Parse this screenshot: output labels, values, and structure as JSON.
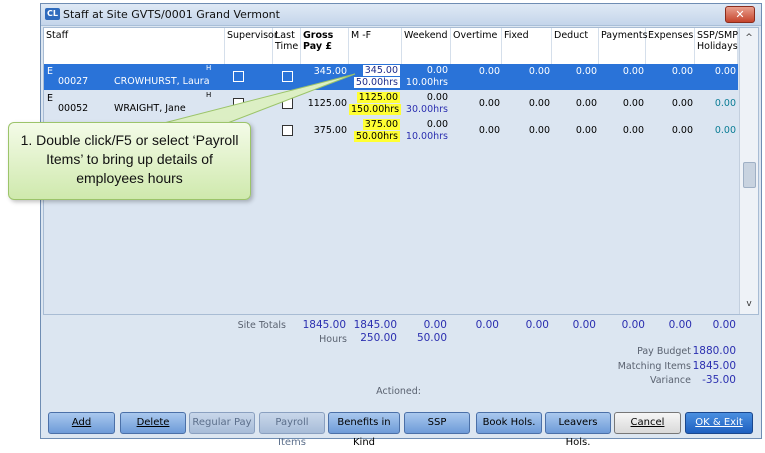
{
  "window": {
    "title": "Staff at Site GVTS/0001 Grand Vermont",
    "icon_text": "CL",
    "close": "✕"
  },
  "columns": [
    {
      "label": "Staff",
      "bold": false
    },
    {
      "label": "Supervisor",
      "bold": false
    },
    {
      "label": "Last Time",
      "bold": false
    },
    {
      "label": "Gross Pay £",
      "bold": true
    },
    {
      "label": "M -F",
      "bold": false
    },
    {
      "label": "Weekend",
      "bold": false
    },
    {
      "label": "Overtime",
      "bold": false
    },
    {
      "label": "Fixed",
      "bold": false
    },
    {
      "label": "Deduct",
      "bold": false
    },
    {
      "label": "Payments",
      "bold": false
    },
    {
      "label": "Expenses",
      "bold": false
    },
    {
      "label": "SSP/SMP Holidays",
      "bold": false
    }
  ],
  "rows": [
    {
      "type": "E",
      "flag": "H",
      "id": "00027",
      "name": "CROWHURST, Laura",
      "gross": "345.00",
      "mf": "345.00",
      "mf_hrs": "50.00hrs",
      "weekend": "0.00",
      "weekend_hrs": "10.00hrs",
      "overtime": "0.00",
      "fixed": "0.00",
      "deduct": "0.00",
      "payments": "0.00",
      "expenses": "0.00",
      "ssp": "0.00"
    },
    {
      "type": "E",
      "flag": "H",
      "id": "00052",
      "name": "WRAIGHT, Jane",
      "gross": "1125.00",
      "mf": "1125.00",
      "mf_hrs": "150.00hrs",
      "weekend": "0.00",
      "weekend_hrs": "30.00hrs",
      "overtime": "0.00",
      "fixed": "0.00",
      "deduct": "0.00",
      "payments": "0.00",
      "expenses": "0.00",
      "ssp": "0.00"
    },
    {
      "type": "",
      "flag": "",
      "id": "",
      "name": "",
      "gross": "375.00",
      "mf": "375.00",
      "mf_hrs": "50.00hrs",
      "weekend": "0.00",
      "weekend_hrs": "10.00hrs",
      "overtime": "0.00",
      "fixed": "0.00",
      "deduct": "0.00",
      "payments": "0.00",
      "expenses": "0.00",
      "ssp": "0.00"
    }
  ],
  "totals": {
    "label": "Site Totals",
    "gross": "1845.00",
    "mf": "1845.00",
    "weekend": "0.00",
    "overtime": "0.00",
    "fixed": "0.00",
    "deduct": "0.00",
    "payments": "0.00",
    "expenses": "0.00",
    "ssp": "0.00",
    "hours_label": "Hours",
    "mf_hours": "250.00",
    "weekend_hours": "50.00"
  },
  "budget": {
    "pay_budget_label": "Pay Budget",
    "pay_budget": "1880.00",
    "matching_label": "Matching Items",
    "matching": "1845.00",
    "variance_label": "Variance",
    "variance": "-35.00",
    "actioned_label": "Actioned:"
  },
  "buttons": {
    "add": "Add",
    "delete": "Delete",
    "regular_pay": "Regular Pay",
    "payroll_items": "Payroll Items",
    "benefits": "Benefits in Kind",
    "ssp": "SSP",
    "book_hols": "Book Hols.",
    "leavers_hols": "Leavers Hols.",
    "cancel": "Cancel",
    "ok": "OK & Exit"
  },
  "callout": {
    "text": "1. Double click/F5 or select ‘Payroll Items’ to bring up details of employees hours"
  },
  "scroll": {
    "up": "^",
    "down": "v"
  },
  "colors": {
    "selected_row": "#2a73d8",
    "highlight": "#ffff33",
    "totals": "#2b2fb0",
    "callout_fill": "#cfe9ad"
  }
}
